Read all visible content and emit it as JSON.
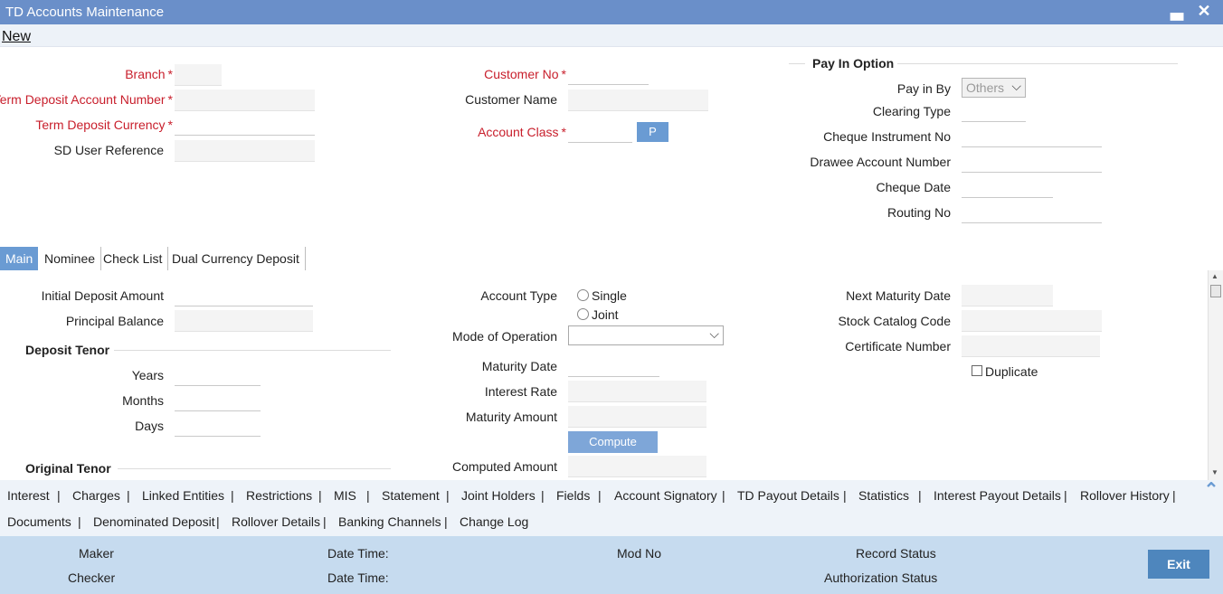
{
  "window": {
    "title": "TD Accounts Maintenance",
    "minimize_glyph": "▃",
    "close_glyph": "✕"
  },
  "menu": {
    "new": "New"
  },
  "header": {
    "branch": {
      "label": "Branch",
      "required": "*"
    },
    "td_account_number": {
      "label": "Term Deposit Account Number",
      "required": "*"
    },
    "td_currency": {
      "label": "Term Deposit Currency",
      "required": "*"
    },
    "sd_user_reference": {
      "label": "SD User Reference"
    },
    "customer_no": {
      "label": "Customer No",
      "required": "*"
    },
    "customer_name": {
      "label": "Customer Name"
    },
    "account_class": {
      "label": "Account Class",
      "required": "*",
      "button": "P"
    }
  },
  "pay_in": {
    "section_title": "Pay In Option",
    "pay_in_by": {
      "label": "Pay in By",
      "value": "Others"
    },
    "clearing_type": "Clearing Type",
    "cheque_instrument_no": "Cheque Instrument No",
    "drawee_account_number": "Drawee Account Number",
    "cheque_date": "Cheque Date",
    "routing_no": "Routing No"
  },
  "tabs": [
    {
      "label": "Main"
    },
    {
      "label": "Nominee"
    },
    {
      "label": "Check List"
    },
    {
      "label": "Dual Currency Deposit"
    }
  ],
  "main": {
    "initial_deposit_amount": "Initial Deposit Amount",
    "principal_balance": "Principal Balance",
    "deposit_tenor": "Deposit Tenor",
    "years": "Years",
    "months": "Months",
    "days": "Days",
    "original_tenor": "Original Tenor",
    "account_type": {
      "label": "Account Type",
      "single": "Single",
      "joint": "Joint"
    },
    "mode_of_operation": "Mode of Operation",
    "maturity_date": "Maturity Date",
    "interest_rate": "Interest Rate",
    "maturity_amount": "Maturity Amount",
    "compute": "Compute",
    "computed_amount": "Computed Amount",
    "next_maturity_date": "Next Maturity Date",
    "stock_catalog_code": "Stock Catalog Code",
    "certificate_number": "Certificate Number",
    "duplicate": "Duplicate"
  },
  "bottom_links": [
    "Interest",
    "Charges",
    "Linked Entities",
    "Restrictions",
    "MIS",
    "Statement",
    "Joint Holders",
    "Fields",
    "Account Signatory",
    "TD Payout Details",
    "Statistics",
    "Interest Payout Details",
    "Rollover History",
    "Documents",
    "Denominated Deposit",
    "Rollover Details",
    "Banking Channels",
    "Change Log"
  ],
  "separator": "|",
  "footer": {
    "maker": "Maker",
    "checker": "Checker",
    "date_time": "Date Time:",
    "mod_no": "Mod No",
    "record_status": "Record Status",
    "authorization_status": "Authorization Status",
    "exit": "Exit"
  },
  "icons": {
    "chevron": "⌵",
    "scroll_up": "▲",
    "scroll_down": "▼",
    "collapse_up": "⌃"
  }
}
